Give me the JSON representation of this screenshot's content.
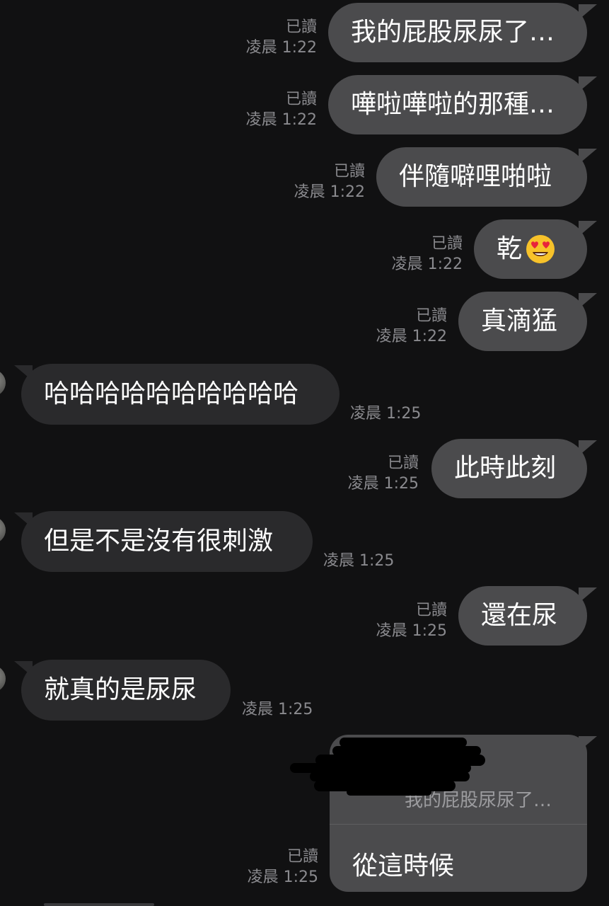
{
  "messages": [
    {
      "dir": "out",
      "text": "我的屁股尿尿了…",
      "read": "已讀",
      "time": "凌晨 1:22"
    },
    {
      "dir": "out",
      "text": "嘩啦嘩啦的那種…",
      "read": "已讀",
      "time": "凌晨 1:22"
    },
    {
      "dir": "out",
      "text": "伴隨噼哩啪啦",
      "read": "已讀",
      "time": "凌晨 1:22"
    },
    {
      "dir": "out",
      "text": "乾",
      "emoji": "heart-eyes-emoji",
      "read": "已讀",
      "time": "凌晨 1:22"
    },
    {
      "dir": "out",
      "text": "真滴猛",
      "read": "已讀",
      "time": "凌晨 1:22"
    },
    {
      "dir": "in",
      "text": "哈哈哈哈哈哈哈哈哈哈",
      "time": "凌晨 1:25"
    },
    {
      "dir": "out",
      "text": "此時此刻",
      "read": "已讀",
      "time": "凌晨 1:25"
    },
    {
      "dir": "in",
      "text": "但是不是沒有很刺激",
      "time": "凌晨 1:25"
    },
    {
      "dir": "out",
      "text": "還在尿",
      "read": "已讀",
      "time": "凌晨 1:25"
    },
    {
      "dir": "in",
      "text": "就真的是尿尿",
      "time": "凌晨 1:25"
    }
  ],
  "reply": {
    "quoted_text": "我的屁股尿尿了…",
    "text": "從這時候",
    "read": "已讀",
    "time": "凌晨 1:25"
  },
  "colors": {
    "background": "#111112",
    "outgoing_bubble": "#4b4b4d",
    "incoming_bubble": "#2a2a2c",
    "meta_text": "#8a8a8e"
  }
}
